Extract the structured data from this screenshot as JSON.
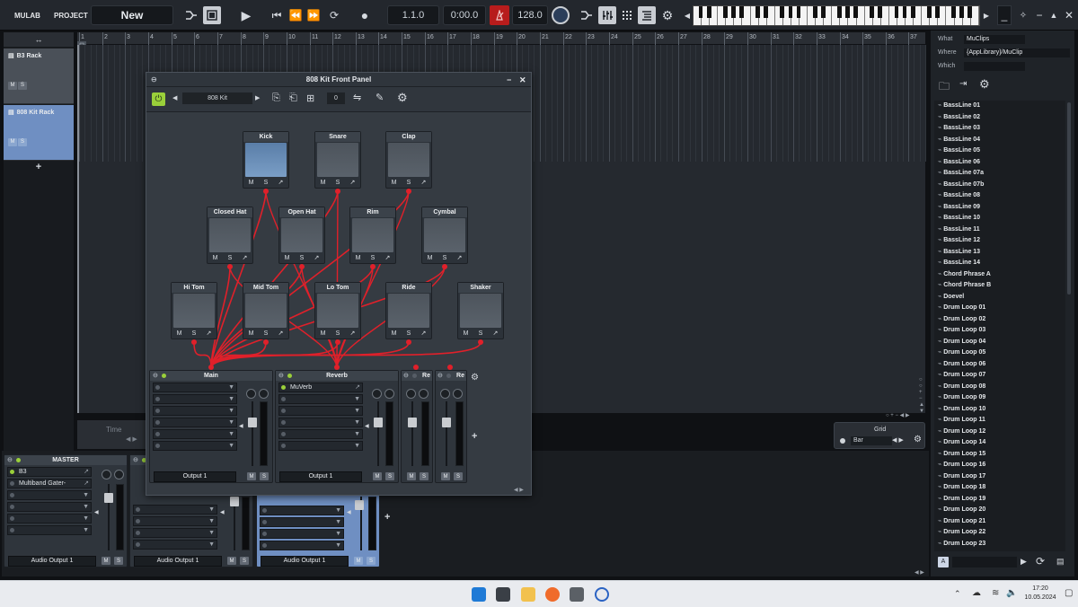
{
  "topbar": {
    "app": "MULAB",
    "project": "PROJECT",
    "session_name": "New",
    "position": "1.1.0",
    "time": "0:00.0",
    "tempo": "128.0"
  },
  "tracks": [
    {
      "name": "B3 Rack",
      "m": "M",
      "s": "S"
    },
    {
      "name": "808 Kit Rack",
      "m": "M",
      "s": "S"
    }
  ],
  "add_track": "+",
  "ruler": [
    "1",
    "2",
    "3",
    "4",
    "5",
    "6",
    "7",
    "8",
    "9",
    "10",
    "11",
    "12",
    "13",
    "14",
    "15",
    "16",
    "17",
    "18",
    "19",
    "20",
    "21",
    "22",
    "23",
    "24",
    "25",
    "26",
    "27",
    "28",
    "29",
    "30",
    "31",
    "32",
    "33",
    "34",
    "35",
    "36",
    "37"
  ],
  "timeline_label": "Time",
  "front_panel": {
    "title": "808 Kit Front Panel",
    "preset": "808 Kit",
    "counter": "0",
    "pads": [
      {
        "name": "Kick"
      },
      {
        "name": "Snare"
      },
      {
        "name": "Clap"
      },
      {
        "name": "Closed Hat"
      },
      {
        "name": "Open Hat"
      },
      {
        "name": "Rim"
      },
      {
        "name": "Cymbal"
      },
      {
        "name": "Hi Tom"
      },
      {
        "name": "Mid Tom"
      },
      {
        "name": "Lo Tom"
      },
      {
        "name": "Ride"
      },
      {
        "name": "Shaker"
      }
    ],
    "pad_m": "M",
    "pad_s": "S",
    "strips": [
      {
        "name": "Main",
        "slot1": "",
        "output": "Output 1"
      },
      {
        "name": "Reverb",
        "slot1": "MuVerb",
        "output": "Output 1"
      },
      {
        "name": "Re"
      },
      {
        "name": "Re"
      }
    ],
    "add": "+"
  },
  "grid_panel": {
    "title": "Grid",
    "value": "Bar"
  },
  "mixer": {
    "master": {
      "name": "MASTER",
      "slot1": "B3",
      "slot2": "Multiband Gater-",
      "output": "Audio Output 1"
    },
    "strip2": {
      "output": "Audio Output 1"
    },
    "strip3": {
      "output": "Audio Output 1"
    },
    "m": "M",
    "s": "S",
    "add": "+"
  },
  "browser": {
    "what_label": "What",
    "what_value": "MuClips",
    "where_label": "Where",
    "where_value": "{AppLibrary}/MuClip",
    "which_label": "Which",
    "items": [
      "BassLine 01",
      "BassLine 02",
      "BassLine 03",
      "BassLine 04",
      "BassLine 05",
      "BassLine 06",
      "BassLine 07a",
      "BassLine 07b",
      "BassLine 08",
      "BassLine 09",
      "BassLine 10",
      "BassLine 11",
      "BassLine 12",
      "BassLine 13",
      "BassLine 14",
      "Chord Phrase A",
      "Chord Phrase B",
      "Doevel",
      "Drum Loop 01",
      "Drum Loop 02",
      "Drum Loop 03",
      "Drum Loop 04",
      "Drum Loop 05",
      "Drum Loop 06",
      "Drum Loop 07",
      "Drum Loop 08",
      "Drum Loop 09",
      "Drum Loop 10",
      "Drum Loop 11",
      "Drum Loop 12",
      "Drum Loop 14",
      "Drum Loop 15",
      "Drum Loop 16",
      "Drum Loop 17",
      "Drum Loop 18",
      "Drum Loop 19",
      "Drum Loop 20",
      "Drum Loop 21",
      "Drum Loop 22",
      "Drum Loop 23"
    ],
    "bottom_a": "A"
  },
  "taskbar": {
    "time": "17:20",
    "date": "10.05.2024"
  },
  "colors": {
    "accent": "#5b7fae",
    "cable": "#e0202a",
    "led": "#9ad03a"
  }
}
